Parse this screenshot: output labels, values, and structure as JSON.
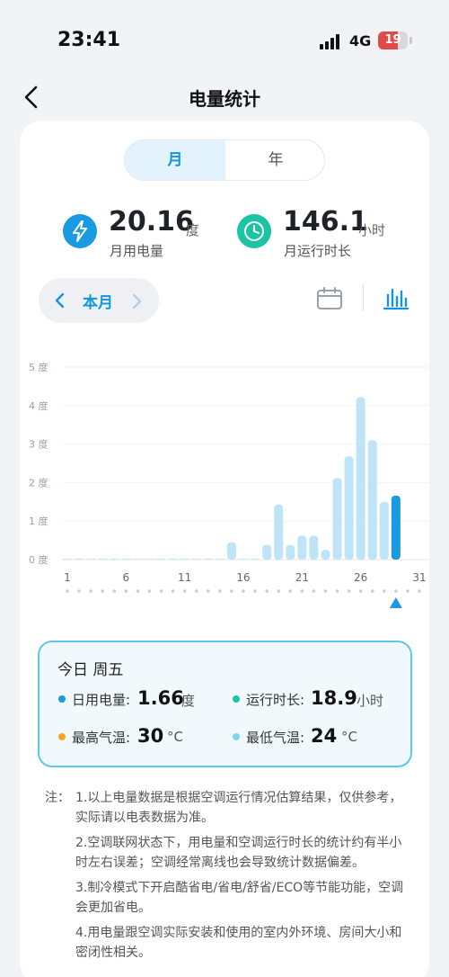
{
  "status_bar": {
    "time": "23:41",
    "network": "4G",
    "battery": "19"
  },
  "header": {
    "title": "电量统计"
  },
  "segmented": {
    "month": "月",
    "year": "年"
  },
  "stats": {
    "usage": {
      "value": "20.16",
      "unit": "度",
      "label": "月用电量"
    },
    "runtime": {
      "value": "146.1",
      "unit": "小时",
      "label": "月运行时长"
    }
  },
  "month_nav": {
    "label": "本月"
  },
  "colors": {
    "accent": "#1296db",
    "bar": "#bfe4f8",
    "bar_selected": "#1a9ae0",
    "usage_icon": "#1a9ae0",
    "runtime_icon": "#1cc4a6",
    "dot_usage": "#1a9ae0",
    "dot_runtime": "#1cc4a6",
    "dot_high": "#f5a623",
    "dot_low": "#7fd3f5"
  },
  "icons": {
    "back": "chevron-left-icon",
    "usage": "lightning-icon",
    "runtime": "clock-icon",
    "calendar": "calendar-icon",
    "bar_chart": "bar-chart-icon",
    "selected_day": "triangle-up-icon"
  },
  "chart_data": {
    "type": "bar",
    "ylim": [
      0,
      5
    ],
    "y_ticks": [
      "0 度",
      "1 度",
      "2 度",
      "3 度",
      "4 度",
      "5 度"
    ],
    "x_tick_labels": [
      "1",
      "6",
      "11",
      "16",
      "21",
      "26",
      "31"
    ],
    "x": [
      1,
      2,
      3,
      4,
      5,
      6,
      7,
      8,
      9,
      10,
      11,
      12,
      13,
      14,
      15,
      16,
      17,
      18,
      19,
      20,
      21,
      22,
      23,
      24,
      25,
      26,
      27,
      28,
      29,
      30,
      31
    ],
    "values": [
      0.02,
      0.02,
      0.02,
      0.02,
      0.02,
      0.02,
      0.02,
      0.02,
      0.02,
      0.02,
      0.02,
      0.02,
      0.02,
      0.02,
      0.45,
      0.02,
      0.02,
      0.38,
      1.43,
      0.38,
      0.62,
      0.62,
      0.25,
      2.12,
      2.68,
      4.22,
      3.1,
      1.5,
      1.66,
      0,
      0
    ],
    "selected_index": 28,
    "grid": true
  },
  "today": {
    "title": "今日  周五",
    "usage": {
      "label": "日用电量:",
      "value": "1.66",
      "unit": "度"
    },
    "runtime": {
      "label": "运行时长:",
      "value": "18.9",
      "unit": "小时"
    },
    "high_temp": {
      "label": "最高气温:",
      "value": "30",
      "unit": "°C"
    },
    "low_temp": {
      "label": "最低气温:",
      "value": "24",
      "unit": "°C"
    }
  },
  "notes": {
    "prefix": "注：",
    "items": [
      "1.以上电量数据是根据空调运行情况估算结果，仅供参考，实际请以电表数据为准。",
      "2.空调联网状态下，用电量和空调运行时长的统计约有半小时左右误差；空调经常离线也会导致统计数据偏差。",
      "3.制冷模式下开启酷省电/省电/舒省/ECO等节能功能，空调会更加省电。",
      "4.用电量跟空调实际安装和使用的室内外环境、房间大小和密闭性相关。"
    ]
  }
}
